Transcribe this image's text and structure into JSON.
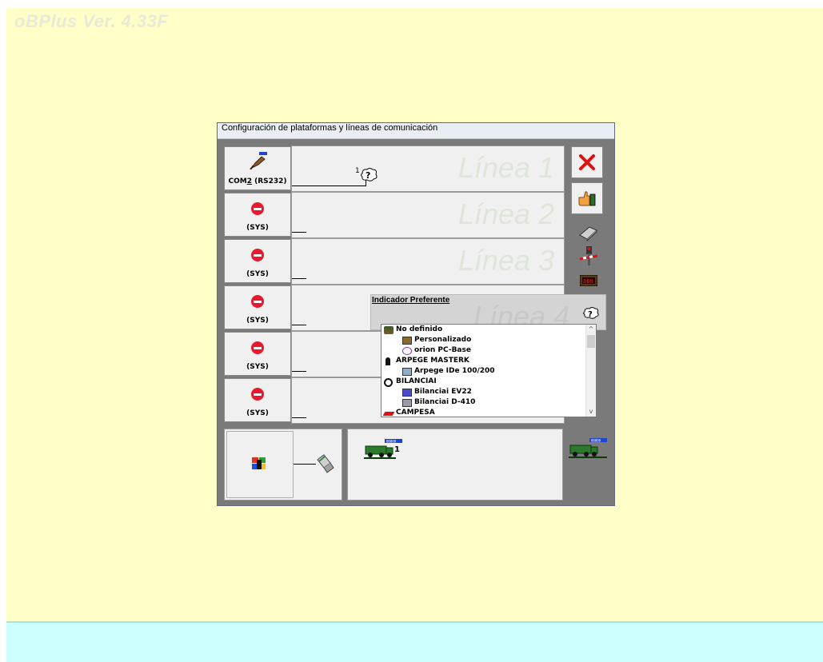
{
  "app": {
    "title": "oBPlus Ver.  4.33F"
  },
  "window": {
    "title": "Configuración de plataformas y líneas de comunicación"
  },
  "lines": [
    {
      "port": "COM2 (RS232)",
      "port_mnemonic": "2",
      "watermark": "Línea 1",
      "indicator_num": "1"
    },
    {
      "port": "(SYS)",
      "watermark": "Línea 2"
    },
    {
      "port": "(SYS)",
      "watermark": "Línea 3"
    },
    {
      "port": "(SYS)",
      "watermark": "Línea 4"
    },
    {
      "port": "(SYS)",
      "watermark": ""
    },
    {
      "port": "(SYS)",
      "watermark": ""
    }
  ],
  "right_panel": {
    "close_icon": "red-x-icon",
    "ok_icon": "thumbs-up-icon",
    "tools": [
      "printer-icon",
      "barrier-icon",
      "display-icon"
    ]
  },
  "bottom": {
    "truck_number": "1"
  },
  "popup": {
    "title": "Indicador Preferente",
    "items": [
      {
        "label": "No definido",
        "level": 0,
        "icon": "tree-icon"
      },
      {
        "label": "Personalizado",
        "level": 1,
        "icon": "toolbox-icon"
      },
      {
        "label": "orion PC-Base",
        "level": 1,
        "icon": "atom-icon"
      },
      {
        "label": "ARPEGE MASTERK",
        "level": 0,
        "icon": "person-icon"
      },
      {
        "label": "Arpege IDe 100/200",
        "level": 1,
        "icon": "device-icon"
      },
      {
        "label": "BILANCIAI",
        "level": 0,
        "icon": "logo-icon"
      },
      {
        "label": "Bilanciai EV22",
        "level": 1,
        "icon": "device-icon"
      },
      {
        "label": "Bilanciai D-410",
        "level": 1,
        "icon": "device-icon"
      },
      {
        "label": "CAMPESA",
        "level": 0,
        "icon": "red-logo-icon"
      }
    ]
  },
  "colors": {
    "desktop": "#ffffc8",
    "band": "#ccffff",
    "window_bg": "#7a7a7a",
    "watermark": "#dfe6d9"
  }
}
